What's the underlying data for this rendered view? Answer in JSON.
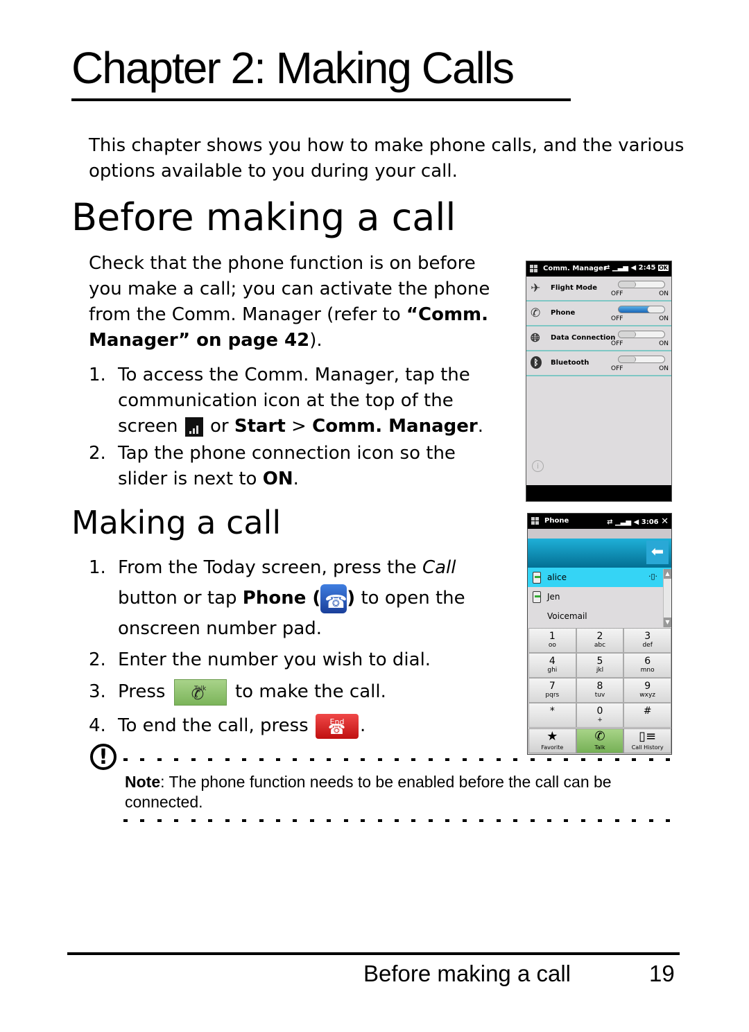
{
  "chapter": {
    "title": "Chapter 2: Making Calls",
    "intro": "This chapter shows you how to make phone calls, and the various options available to you during your call."
  },
  "section_before": {
    "title": "Before making a call",
    "para_start": "Check that the phone function is on before you make a call; you can activate the phone from the Comm. Manager (refer to ",
    "para_ref": "“Comm. Manager” on page 42",
    "para_end": ").",
    "steps": [
      {
        "num": "1.",
        "text_a": "To access the Comm. Manager, tap the communication icon at the top of the screen ",
        "icon": "signal-icon",
        "text_b": " or ",
        "bold_b": "Start",
        "text_c": " > ",
        "bold_c": "Comm. Manager",
        "text_d": "."
      },
      {
        "num": "2.",
        "text_a": "Tap the phone connection icon so the slider is next to ",
        "bold_a": "ON",
        "text_b": "."
      }
    ]
  },
  "section_making": {
    "title": "Making a call",
    "steps": [
      {
        "num": "1.",
        "text_a": "From the Today screen, press the ",
        "italic_a": "Call",
        "text_b": " button or tap ",
        "bold_b": "Phone (",
        "icon": "phone-app-icon",
        "bold_c": ")",
        "text_c": " to open the onscreen number pad."
      },
      {
        "num": "2.",
        "text_a": "Enter the number you wish to dial."
      },
      {
        "num": "3.",
        "text_a": "Press ",
        "icon": "talk-button-icon",
        "icon_label": "Talk",
        "text_b": " to make the call."
      },
      {
        "num": "4.",
        "text_a": "To end the call, press ",
        "icon": "end-button-icon",
        "icon_label": "End",
        "text_b": "."
      }
    ]
  },
  "comm_manager_screen": {
    "title": "Comm. Manager",
    "time": "2:45",
    "ok": "ok",
    "off_label": "OFF",
    "on_label": "ON",
    "rows": [
      {
        "label": "Flight Mode",
        "icon": "airplane-icon",
        "state": "off"
      },
      {
        "label": "Phone",
        "icon": "phone-signal-icon",
        "state": "on"
      },
      {
        "label": "Data Connection",
        "icon": "globe-icon",
        "state": "off"
      },
      {
        "label": "Bluetooth",
        "icon": "bluetooth-icon",
        "state": "off"
      }
    ]
  },
  "phone_screen": {
    "title": "Phone",
    "time": "3:06",
    "contacts": [
      {
        "name": "alice",
        "selected": true
      },
      {
        "name": "Jen",
        "selected": false
      },
      {
        "name": "Voicemail",
        "selected": false
      }
    ],
    "keys": [
      {
        "digit": "1",
        "letters": "oo"
      },
      {
        "digit": "2",
        "letters": "abc"
      },
      {
        "digit": "3",
        "letters": "def"
      },
      {
        "digit": "4",
        "letters": "ghi"
      },
      {
        "digit": "5",
        "letters": "jkl"
      },
      {
        "digit": "6",
        "letters": "mno"
      },
      {
        "digit": "7",
        "letters": "pqrs"
      },
      {
        "digit": "8",
        "letters": "tuv"
      },
      {
        "digit": "9",
        "letters": "wxyz"
      },
      {
        "digit": "*",
        "letters": ""
      },
      {
        "digit": "0",
        "letters": "+"
      },
      {
        "digit": "#",
        "letters": ""
      }
    ],
    "bottom": [
      {
        "label": "Favorite",
        "glyph": "★"
      },
      {
        "label": "Talk",
        "glyph": "✆"
      },
      {
        "label": "Call History",
        "glyph": "▯≡"
      }
    ]
  },
  "note": {
    "label": "Note",
    "text": ": The phone function needs to be enabled before the call can be connected."
  },
  "footer": {
    "section": "Before making a call",
    "page": "19"
  }
}
